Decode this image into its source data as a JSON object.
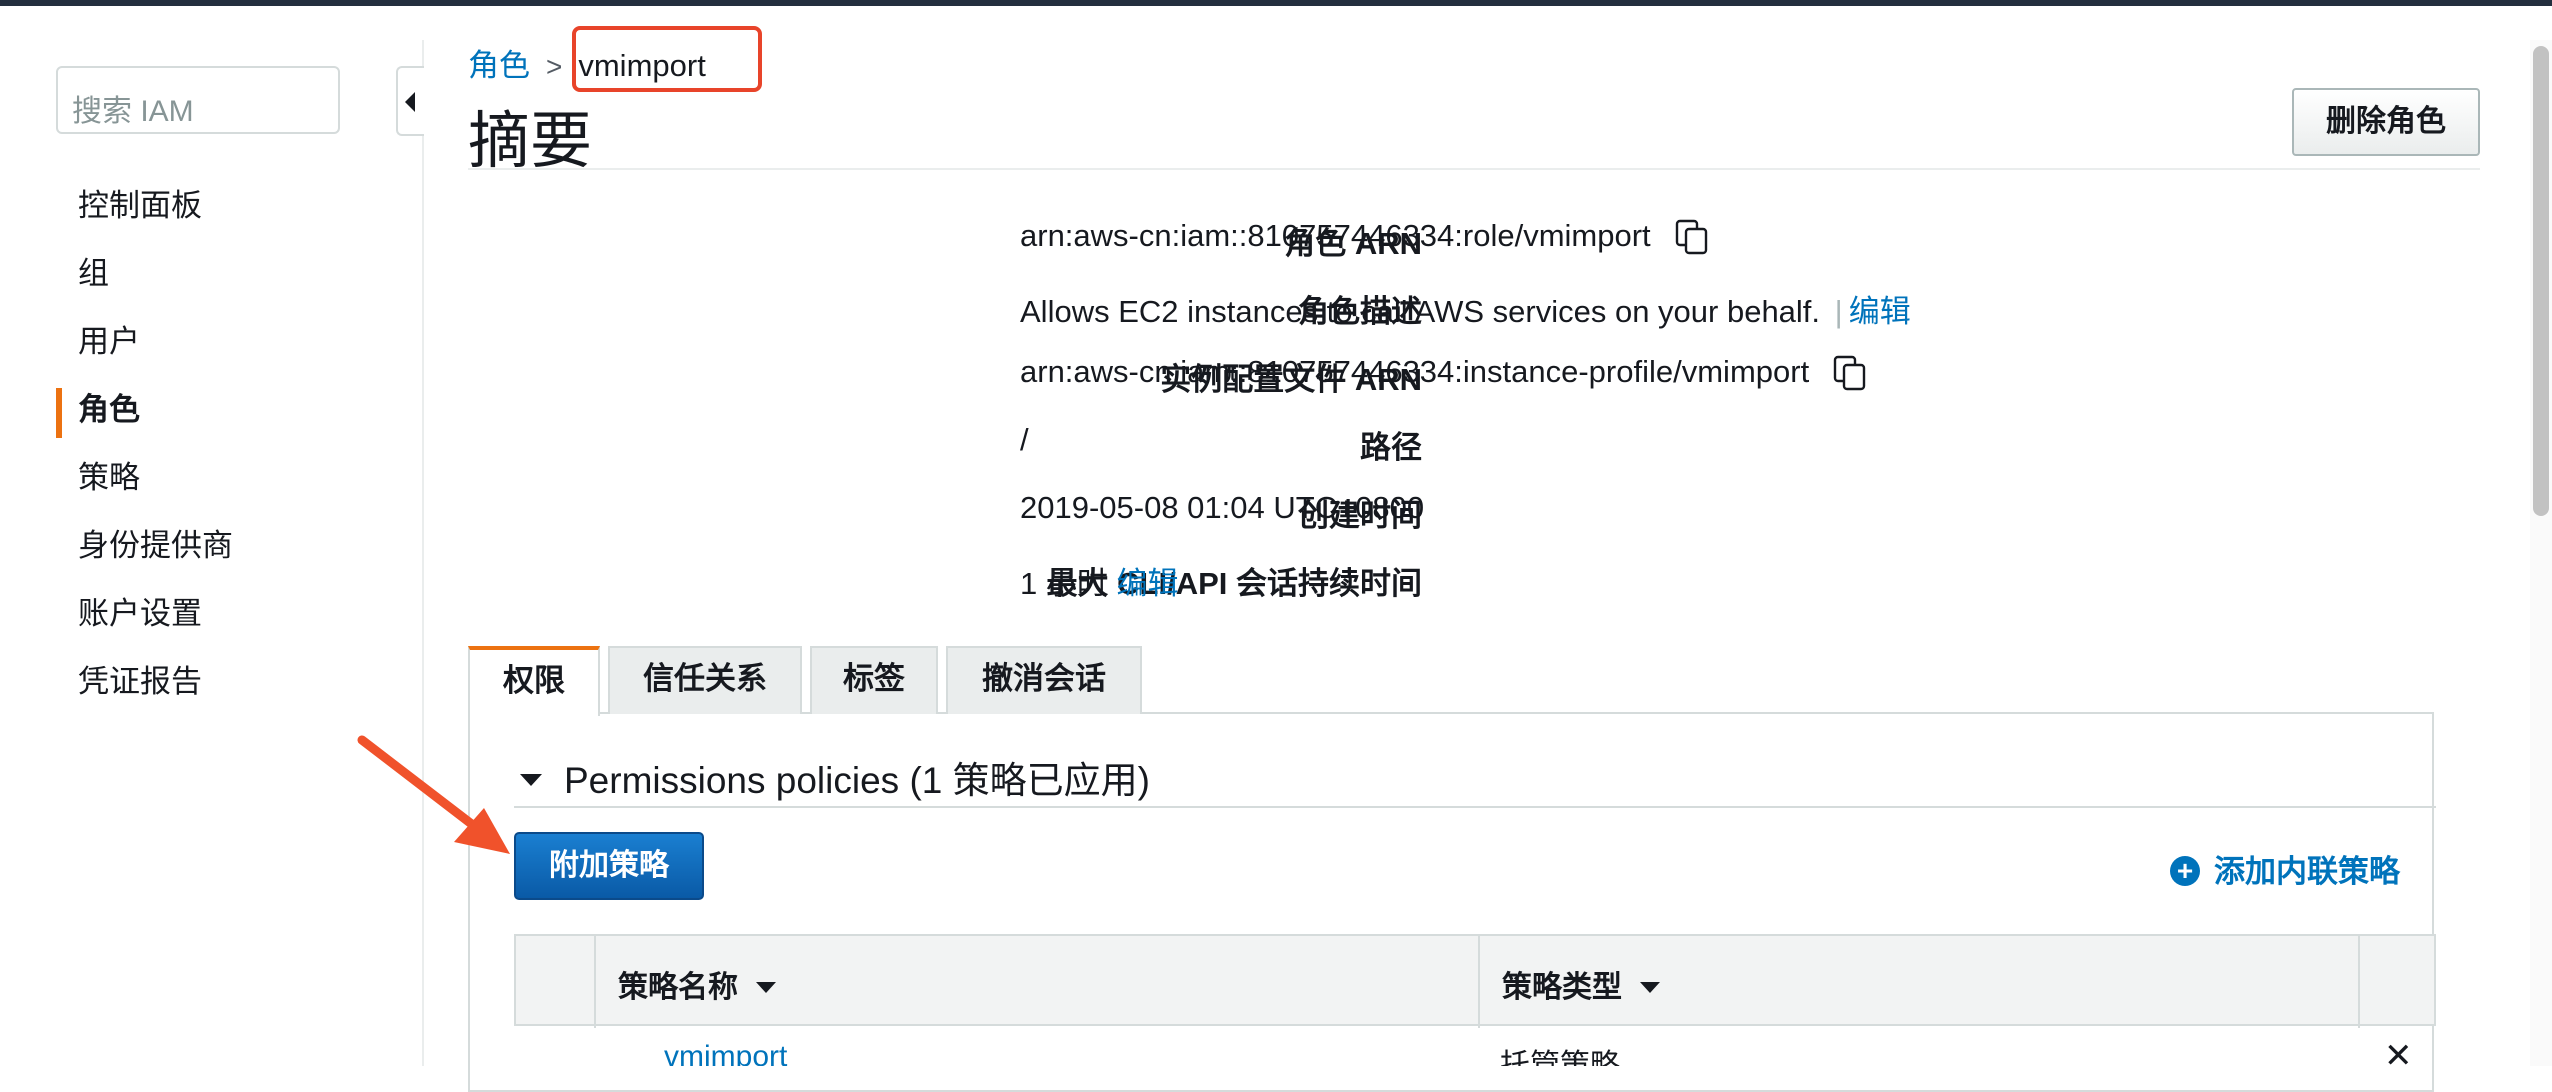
{
  "sidebar": {
    "search_placeholder": "搜索 IAM",
    "items": [
      {
        "label": "控制面板"
      },
      {
        "label": "组"
      },
      {
        "label": "用户"
      },
      {
        "label": "角色"
      },
      {
        "label": "策略"
      },
      {
        "label": "身份提供商"
      },
      {
        "label": "账户设置"
      },
      {
        "label": "凭证报告"
      }
    ],
    "active_item": "角色"
  },
  "breadcrumb": {
    "parent": "角色",
    "separator": ">",
    "current": "vmimport"
  },
  "page": {
    "title": "摘要",
    "delete_button": "删除角色"
  },
  "summary": {
    "role_arn": {
      "label": "角色 ARN",
      "value": "arn:aws-cn:iam::810757446334:role/vmimport"
    },
    "description": {
      "label": "角色描述",
      "value": "Allows EC2 instances to call AWS services on your behalf.",
      "separator": "|",
      "edit": "编辑"
    },
    "instance_profile_arn": {
      "label": "实例配置文件 ARN",
      "value": "arn:aws-cn:iam::810757446334:instance-profile/vmimport"
    },
    "path": {
      "label": "路径",
      "value": "/"
    },
    "created": {
      "label": "创建时间",
      "value": "2019-05-08 01:04 UTC+0800"
    },
    "max_session": {
      "label": "最大 CLI/API 会话持续时间",
      "value": "1 小时",
      "edit": "编辑"
    }
  },
  "tabs": [
    {
      "label": "权限"
    },
    {
      "label": "信任关系"
    },
    {
      "label": "标签"
    },
    {
      "label": "撤消会话"
    }
  ],
  "permissions": {
    "heading": "Permissions policies (1 策略已应用)",
    "attach_button": "附加策略",
    "add_inline": "添加内联策略",
    "columns": {
      "name": "策略名称",
      "type": "策略类型"
    },
    "rows": [
      {
        "name": "vmimport",
        "type": "托管策略",
        "remove": "✕"
      }
    ]
  },
  "icons": {
    "copy": "copy-icon",
    "add": "plus-circle-icon",
    "collapse": "collapse-sidebar-icon"
  },
  "colors": {
    "link": "#0073bb",
    "active_accent": "#ec7211",
    "primary_button": "#0a5aa6",
    "annotation_red": "#e8442a"
  }
}
